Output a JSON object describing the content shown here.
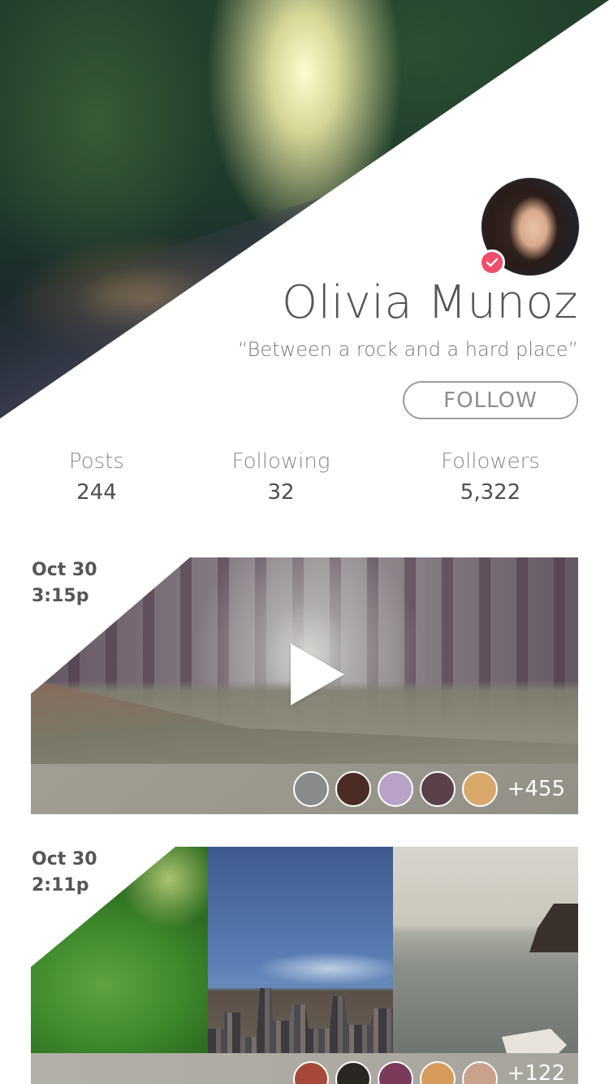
{
  "profile": {
    "name": "Olivia Munoz",
    "bio": "“Between a rock and a hard place”",
    "follow_label": "FOLLOW",
    "verified_icon": "check-icon",
    "accent_color": "#ef4d6c"
  },
  "stats": {
    "posts": {
      "label": "Posts",
      "value": "244"
    },
    "following": {
      "label": "Following",
      "value": "32"
    },
    "followers": {
      "label": "Followers",
      "value": "5,322"
    }
  },
  "posts": [
    {
      "date": "Oct 30",
      "time": "3:15p",
      "type": "video",
      "play_icon": "play-icon",
      "likers_extra": "+455",
      "liker_colors": [
        "#8a8a8a",
        "#4a2c24",
        "#b9a2c8",
        "#5a4048",
        "#d7a86a"
      ]
    },
    {
      "date": "Oct 30",
      "time": "2:11p",
      "type": "photos",
      "photos": [
        "leaf-photo",
        "city-photo",
        "sea-photo"
      ],
      "likers_extra": "+122",
      "liker_colors": [
        "#a8483a",
        "#2a2622",
        "#7a3a5a",
        "#d89a5a",
        "#c8a28a"
      ]
    }
  ]
}
